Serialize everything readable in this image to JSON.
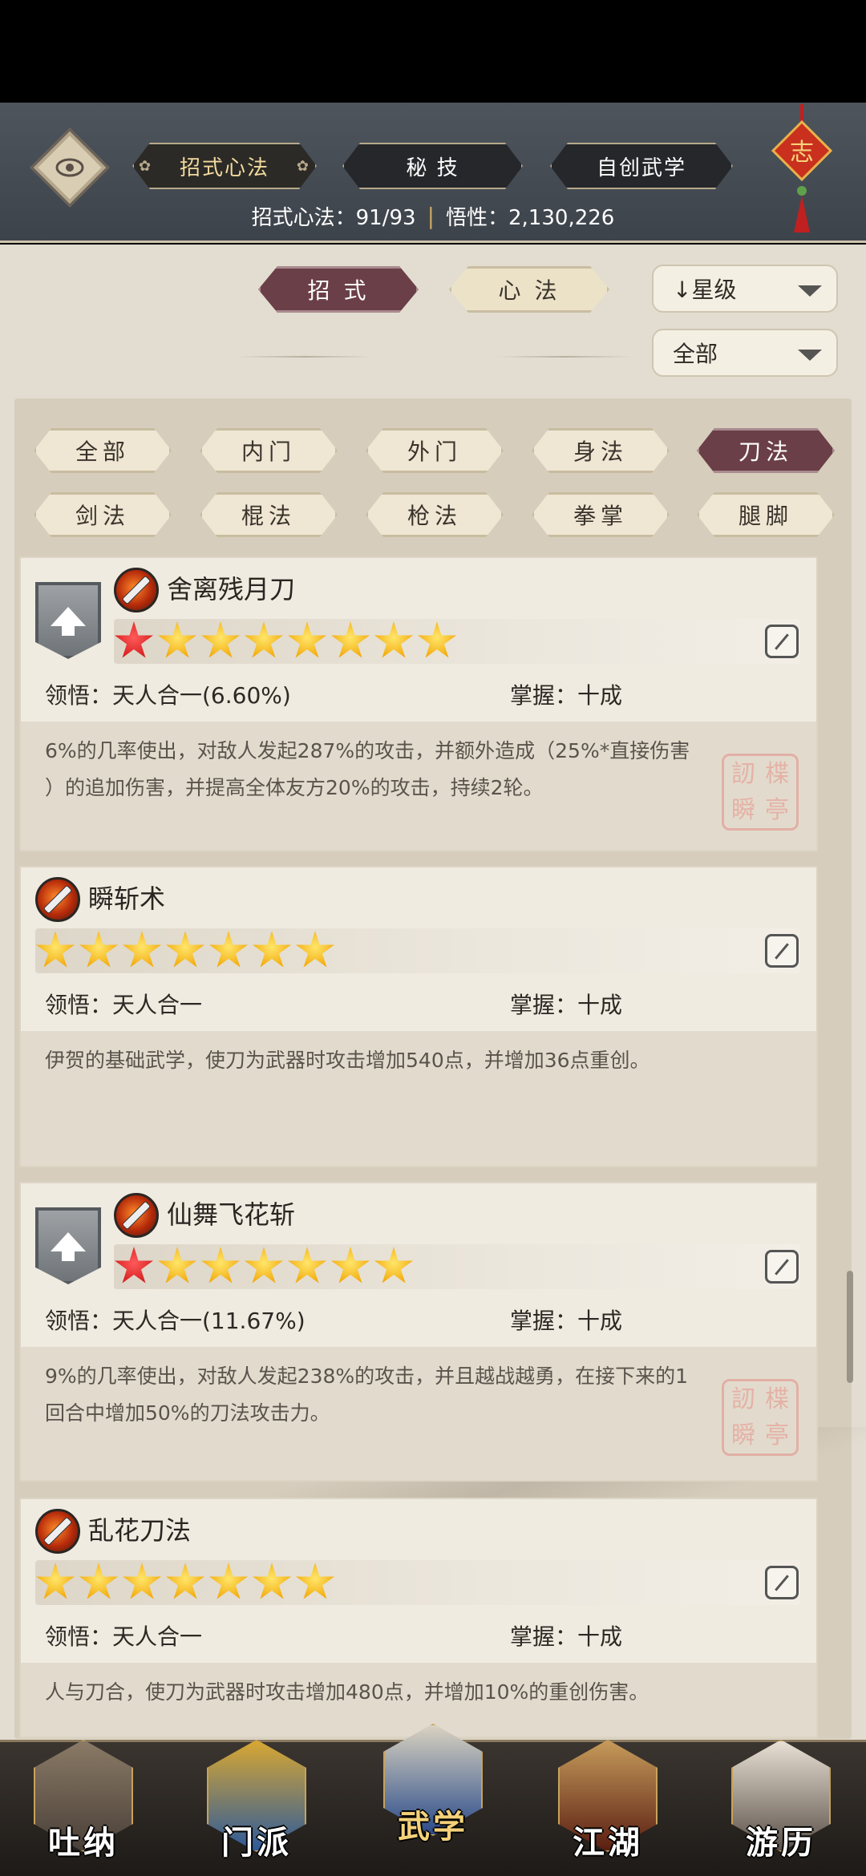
{
  "top_tabs": [
    {
      "label": "招式心法",
      "active": true
    },
    {
      "label": "秘 技",
      "active": false
    },
    {
      "label": "自创武学",
      "active": false
    }
  ],
  "knot_char": "志",
  "stats": {
    "text1": "招式心法：91/93",
    "sep": "|",
    "text2": "悟性：2,130,226"
  },
  "mode_tabs": [
    {
      "label": "招 式",
      "active": true
    },
    {
      "label": "心 法",
      "active": false
    }
  ],
  "sort_select": "↓星级",
  "filter_select": "全部",
  "filter_tabs": [
    {
      "label": "全部",
      "active": false
    },
    {
      "label": "内门",
      "active": false
    },
    {
      "label": "外门",
      "active": false
    },
    {
      "label": "身法",
      "active": false
    },
    {
      "label": "刀法",
      "active": true
    },
    {
      "label": "剑法",
      "active": false
    },
    {
      "label": "棍法",
      "active": false
    },
    {
      "label": "枪法",
      "active": false
    },
    {
      "label": "拳掌",
      "active": false
    },
    {
      "label": "腿脚",
      "active": false
    }
  ],
  "skills": [
    {
      "name": "舍离残月刀",
      "stars_red": 1,
      "stars_gold": 7,
      "upgradable": true,
      "comprehension": "领悟：天人合一(6.60%)",
      "mastery": "掌握：十成",
      "desc1": "6%的几率使出，对敌人发起287%的攻击，并额外造成（25%*直接伤害",
      "desc2": "）的追加伤害，并提高全体友方20%的攻击，持续2轮。",
      "seal": true
    },
    {
      "name": "瞬斩术",
      "stars_red": 0,
      "stars_gold": 7,
      "upgradable": false,
      "comprehension": "领悟：天人合一",
      "mastery": "掌握：十成",
      "desc1": "伊贺的基础武学，使刀为武器时攻击增加540点，并增加36点重创。",
      "desc2": "",
      "seal": false
    },
    {
      "name": "仙舞飞花斩",
      "stars_red": 1,
      "stars_gold": 6,
      "upgradable": true,
      "comprehension": "领悟：天人合一(11.67%)",
      "mastery": "掌握：十成",
      "desc1": "9%的几率使出，对敌人发起238%的攻击，并且越战越勇，在接下来的1",
      "desc2": "回合中增加50%的刀法攻击力。",
      "seal": true
    },
    {
      "name": "乱花刀法",
      "stars_red": 0,
      "stars_gold": 7,
      "upgradable": false,
      "comprehension": "领悟：天人合一",
      "mastery": "掌握：十成",
      "desc1": "人与刀合，使刀为武器时攻击增加480点，并增加10%的重创伤害。",
      "desc2": "",
      "seal": false
    }
  ],
  "seal_chars": [
    "訒",
    "楪",
    "瞬",
    "亭"
  ],
  "nav": [
    {
      "label": "吐纳",
      "active": false
    },
    {
      "label": "门派",
      "active": false
    },
    {
      "label": "武学",
      "active": true
    },
    {
      "label": "江湖",
      "active": false
    },
    {
      "label": "游历",
      "active": false
    }
  ]
}
